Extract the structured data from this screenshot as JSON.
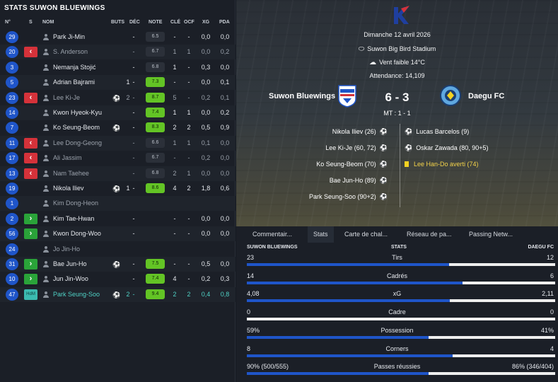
{
  "left": {
    "title": "STATS SUWON BLUEWINGS",
    "headers": {
      "n": "N°",
      "s": "S",
      "nom": "NOM",
      "buts": "BUTS",
      "dec": "DÉC",
      "note": "NOTE",
      "cle": "CLÉ",
      "ocf": "OCF",
      "xg": "XG",
      "pda": "PDA"
    },
    "players": [
      {
        "num": "29",
        "sub": "",
        "name": "Park Ji-Min",
        "style": "normal",
        "ball": "",
        "buts": "",
        "dec": "-",
        "note": "6.5",
        "noteColor": "grey",
        "cle": "-",
        "ocf": "-",
        "xg": "0,0",
        "pda": "0,0"
      },
      {
        "num": "20",
        "sub": "out",
        "name": "S. Anderson",
        "style": "dim",
        "ball": "",
        "buts": "",
        "dec": "-",
        "note": "6.7",
        "noteColor": "grey",
        "cle": "1",
        "ocf": "1",
        "xg": "0,0",
        "pda": "0,2"
      },
      {
        "num": "3",
        "sub": "",
        "name": "Nemanja Stojić",
        "style": "normal",
        "ball": "",
        "buts": "",
        "dec": "-",
        "note": "6.8",
        "noteColor": "grey",
        "cle": "1",
        "ocf": "-",
        "xg": "0,3",
        "pda": "0,0"
      },
      {
        "num": "5",
        "sub": "",
        "name": "Adrian Bajrami",
        "style": "normal",
        "ball": "",
        "buts": "1",
        "dec": "-",
        "note": "7.3",
        "noteColor": "green",
        "cle": "-",
        "ocf": "-",
        "xg": "0,0",
        "pda": "0,1"
      },
      {
        "num": "23",
        "sub": "out",
        "name": "Lee Ki-Je",
        "style": "dim",
        "ball": "⚽",
        "buts": "2",
        "dec": "-",
        "note": "8.7",
        "noteColor": "green",
        "cle": "5",
        "ocf": "-",
        "xg": "0,2",
        "pda": "0,1"
      },
      {
        "num": "14",
        "sub": "",
        "name": "Kwon Hyeok-Kyu",
        "style": "normal",
        "ball": "",
        "buts": "",
        "dec": "-",
        "note": "7.4",
        "noteColor": "green",
        "cle": "1",
        "ocf": "1",
        "xg": "0,0",
        "pda": "0,2"
      },
      {
        "num": "7",
        "sub": "",
        "name": "Ko Seung-Beom",
        "style": "normal",
        "ball": "⚽",
        "buts": "",
        "dec": "-",
        "note": "8.3",
        "noteColor": "green",
        "cle": "2",
        "ocf": "2",
        "xg": "0,5",
        "pda": "0,9"
      },
      {
        "num": "11",
        "sub": "out",
        "name": "Lee Dong-Geong",
        "style": "dim",
        "ball": "",
        "buts": "",
        "dec": "-",
        "note": "6.6",
        "noteColor": "grey",
        "cle": "1",
        "ocf": "1",
        "xg": "0,1",
        "pda": "0,0"
      },
      {
        "num": "17",
        "sub": "out",
        "name": "Ali Jassim",
        "style": "dim",
        "ball": "",
        "buts": "",
        "dec": "-",
        "note": "6.7",
        "noteColor": "grey",
        "cle": "-",
        "ocf": "-",
        "xg": "0,2",
        "pda": "0,0"
      },
      {
        "num": "13",
        "sub": "out",
        "name": "Nam Taehee",
        "style": "dim",
        "ball": "",
        "buts": "",
        "dec": "-",
        "note": "6.8",
        "noteColor": "grey",
        "cle": "2",
        "ocf": "1",
        "xg": "0,0",
        "pda": "0,0"
      },
      {
        "num": "19",
        "sub": "",
        "name": "Nikola Iliev",
        "style": "normal",
        "ball": "⚽",
        "buts": "1",
        "dec": "-",
        "note": "8.6",
        "noteColor": "green",
        "cle": "4",
        "ocf": "2",
        "xg": "1,8",
        "pda": "0,6"
      },
      {
        "num": "1",
        "sub": "",
        "name": "Kim Dong-Heon",
        "style": "dim",
        "ball": "",
        "buts": "",
        "dec": "",
        "note": "",
        "noteColor": "none",
        "cle": "",
        "ocf": "",
        "xg": "",
        "pda": ""
      },
      {
        "num": "2",
        "sub": "in",
        "name": "Kim Tae-Hwan",
        "style": "normal",
        "ball": "",
        "buts": "",
        "dec": "-",
        "note": "",
        "noteColor": "none",
        "cle": "-",
        "ocf": "-",
        "xg": "0,0",
        "pda": "0,0"
      },
      {
        "num": "56",
        "sub": "in",
        "name": "Kwon Dong-Woo",
        "style": "normal",
        "ball": "",
        "buts": "",
        "dec": "-",
        "note": "",
        "noteColor": "none",
        "cle": "-",
        "ocf": "-",
        "xg": "0,0",
        "pda": "0,0"
      },
      {
        "num": "24",
        "sub": "",
        "name": "Jo Jin-Ho",
        "style": "dim",
        "ball": "",
        "buts": "",
        "dec": "",
        "note": "",
        "noteColor": "none",
        "cle": "",
        "ocf": "",
        "xg": "",
        "pda": ""
      },
      {
        "num": "31",
        "sub": "in",
        "name": "Bae Jun-Ho",
        "style": "normal",
        "ball": "⚽",
        "buts": "",
        "dec": "-",
        "note": "7.5",
        "noteColor": "green",
        "cle": "-",
        "ocf": "-",
        "xg": "0,5",
        "pda": "0,0"
      },
      {
        "num": "10",
        "sub": "in",
        "name": "Jun Jin-Woo",
        "style": "normal",
        "ball": "",
        "buts": "",
        "dec": "-",
        "note": "7.4",
        "noteColor": "green",
        "cle": "4",
        "ocf": "-",
        "xg": "0,2",
        "pda": "0,3"
      },
      {
        "num": "47",
        "sub": "hdm",
        "name": "Park Seung-Soo",
        "style": "teal",
        "ball": "⚽",
        "buts": "2",
        "dec": "-",
        "note": "9.4",
        "noteColor": "green",
        "cle": "2",
        "ocf": "2",
        "xg": "0,4",
        "pda": "0,8"
      }
    ],
    "hdm_label": "HdM"
  },
  "match": {
    "date": "Dimanche 12 avril 2026",
    "stadium": "Suwon Big Bird Stadium",
    "weather": "Vent faible 14°C",
    "attendance": "Attendance: 14,109",
    "home": "Suwon Bluewings",
    "away": "Daegu FC",
    "score": "6 - 3",
    "ht": "MT : 1 - 1",
    "home_events": [
      "Nikola Iliev (26)",
      "Lee Ki-Je (60, 72)",
      "Ko Seung-Beom (70)",
      "Bae Jun-Ho (89)",
      "Park Seung-Soo (90+2)"
    ],
    "away_events": [
      {
        "text": "Lucas Barcelos (9)",
        "type": "goal"
      },
      {
        "text": "Oskar Zawada (80, 90+5)",
        "type": "goal"
      },
      {
        "text": "Lee Han-Do averti (74)",
        "type": "yellow"
      }
    ]
  },
  "tabs": [
    "Commentair...",
    "Stats",
    "Carte de chal...",
    "Réseau de pa...",
    "Passing Netw..."
  ],
  "stats": {
    "home_label": "SUWON BLUEWINGS",
    "mid_label": "STATS",
    "away_label": "DAEGU FC",
    "rows": [
      {
        "label": "Tirs",
        "home": "23",
        "away": "12",
        "home_share": 0.657
      },
      {
        "label": "Cadrés",
        "home": "14",
        "away": "6",
        "home_share": 0.7
      },
      {
        "label": "xG",
        "home": "4,08",
        "away": "2,11",
        "home_share": 0.659
      },
      {
        "label": "Cadre",
        "home": "0",
        "away": "0",
        "home_share": 0
      },
      {
        "label": "Possession",
        "home": "59%",
        "away": "41%",
        "home_share": 0.59
      },
      {
        "label": "Corners",
        "home": "8",
        "away": "4",
        "home_share": 0.667
      },
      {
        "label": "Passes réussies",
        "home": "90% (500/555)",
        "away": "86% (346/404)",
        "home_share": 0.59
      }
    ]
  },
  "colors": {
    "accent_blue": "#1f55c9",
    "note_green": "#63c425",
    "sub_out": "#d5323a",
    "sub_in": "#2aa339",
    "hdm": "#3bbbb0"
  }
}
